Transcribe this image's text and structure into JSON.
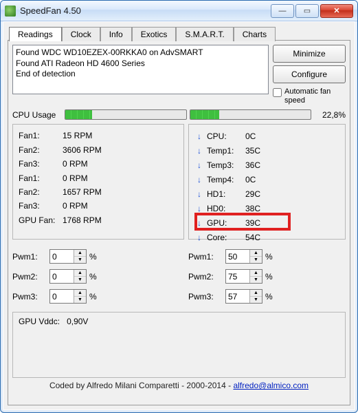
{
  "window": {
    "title": "SpeedFan 4.50"
  },
  "tabs": [
    "Readings",
    "Clock",
    "Info",
    "Exotics",
    "S.M.A.R.T.",
    "Charts"
  ],
  "active_tab": 0,
  "log_lines": [
    "Found WDC WD10EZEX-00RKKA0 on AdvSMART",
    "Found ATI Radeon HD 4600 Series",
    "End of detection"
  ],
  "buttons": {
    "minimize": "Minimize",
    "configure": "Configure"
  },
  "auto_fan": {
    "label": "Automatic fan speed",
    "checked": false
  },
  "cpu": {
    "label": "CPU Usage",
    "bar1_pct": 22,
    "bar2_pct": 24,
    "text": "22,8%"
  },
  "fans": [
    {
      "label": "Fan1:",
      "value": "15 RPM"
    },
    {
      "label": "Fan2:",
      "value": "3606 RPM"
    },
    {
      "label": "Fan3:",
      "value": "0 RPM"
    },
    {
      "label": "Fan1:",
      "value": "0 RPM"
    },
    {
      "label": "Fan2:",
      "value": "1657 RPM"
    },
    {
      "label": "Fan3:",
      "value": "0 RPM"
    },
    {
      "label": "GPU Fan:",
      "value": "1768 RPM"
    }
  ],
  "temps": [
    {
      "label": "CPU:",
      "value": "0C"
    },
    {
      "label": "Temp1:",
      "value": "35C"
    },
    {
      "label": "Temp3:",
      "value": "36C"
    },
    {
      "label": "Temp4:",
      "value": "0C"
    },
    {
      "label": "HD1:",
      "value": "29C"
    },
    {
      "label": "HD0:",
      "value": "38C"
    },
    {
      "label": "GPU:",
      "value": "39C"
    },
    {
      "label": "Core:",
      "value": "54C"
    }
  ],
  "highlight_index": 6,
  "pwm_left": [
    {
      "label": "Pwm1:",
      "value": "0",
      "unit": "%"
    },
    {
      "label": "Pwm2:",
      "value": "0",
      "unit": "%"
    },
    {
      "label": "Pwm3:",
      "value": "0",
      "unit": "%"
    }
  ],
  "pwm_right": [
    {
      "label": "Pwm1:",
      "value": "50",
      "unit": "%"
    },
    {
      "label": "Pwm2:",
      "value": "75",
      "unit": "%"
    },
    {
      "label": "Pwm3:",
      "value": "57",
      "unit": "%"
    }
  ],
  "vdd": {
    "label": "GPU Vddc:",
    "value": "0,90V"
  },
  "footer": {
    "prefix": "Coded by Alfredo Milani Comparetti - 2000-2014 - ",
    "email": "alfredo@almico.com"
  }
}
